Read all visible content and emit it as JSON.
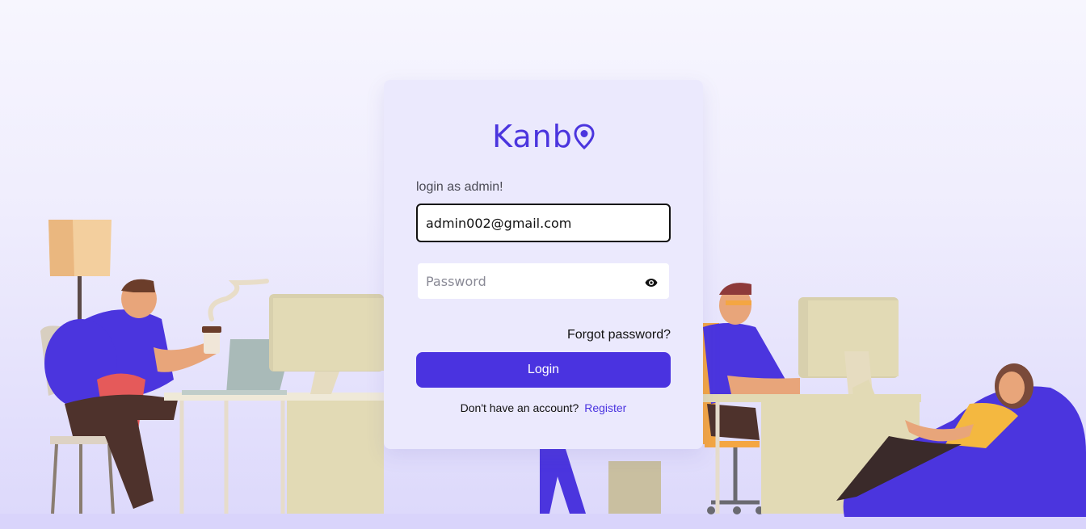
{
  "brand": {
    "name": "Kanb",
    "accent_color": "#4a33e0",
    "logo_icon": "map-pin-icon"
  },
  "form": {
    "heading": "login as admin!",
    "email_value": "admin002@gmail.com",
    "password_placeholder": "Password",
    "show_password_icon": "eye-icon",
    "forgot_label": "Forgot password?",
    "login_label": "Login",
    "no_account_text": "Don't have an account?",
    "register_label": "Register"
  }
}
